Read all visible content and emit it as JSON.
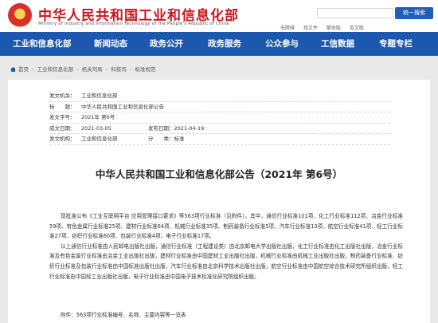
{
  "header": {
    "title": "中华人民共和国工业和信息化部",
    "subtitle": "Ministry of Industry and Information Technology of the People's Republic of China",
    "search_label": "统一搜索",
    "top_links": [
      "无障碍",
      "找文件",
      "繁体版",
      "英文版"
    ]
  },
  "nav": {
    "items": [
      "工业和信息化部",
      "新闻动态",
      "政务公开",
      "政务服务",
      "公众参与",
      "工信数据",
      "专题专栏"
    ]
  },
  "breadcrumb": [
    "首页",
    "工业和信息化部",
    "机关司局",
    "科技司",
    "标准规范"
  ],
  "meta": {
    "issuer_key": "发文机关：",
    "issuer": "工业和信息化部",
    "title_key": "标　　题：",
    "title": "中华人民共和国工业和信息化部公告",
    "number_key": "发文字号：",
    "number": "2021年 第6号",
    "date_key": "成文日期：",
    "date": "2021-03-05",
    "publish_key": "发布日期：",
    "publish": "2021-04-19",
    "org_key": "发文机构：",
    "org": "工业和信息化部",
    "category_key": "分　　类：",
    "category": "标准"
  },
  "document": {
    "title": "中华人民共和国工业和信息化部公告（2021年 第6号）",
    "paragraph1": "现批准公布《工业互联网平台 应用管理接口要求》等563项行业标准（见附件）。其中，通信行业标准101项、化工行业标准112项、冶金行业标准59项、有色金属行业标准25项、建材行业标准64项、机械行业标准35项、制药装备行业标准5项、汽车行业标准13项、航空行业标准41项、轻工行业标准27项、纺织行业标准60项、包装行业标准4项、电子行业标准17项。",
    "paragraph2": "以上通信行业标准由人民邮电出版社出版，通信行业标准（工程建设类）由北京邮电大学出版社出版，化工行业标准由化工出版社出版，冶金行业标准及有色金属行业标准由冶金工业出版社出版，建材行业标准由中国建材工业出版社出版，机械行业标准由机械工业出版社出版，制药装备行业标准、纺织行业标准及包装行业标准由中国标准出版社出版，汽车行业标准由北京科学技术出版社出版，航空行业标准由中国航空综合技术研究所组织出版，轻工行业标准由中国轻工业出版社出版，电子行业标准由中国电子技术标准化研究院组织出版。",
    "attachment": "附件：563项行业标准编号、名称、主要内容等一览表"
  }
}
